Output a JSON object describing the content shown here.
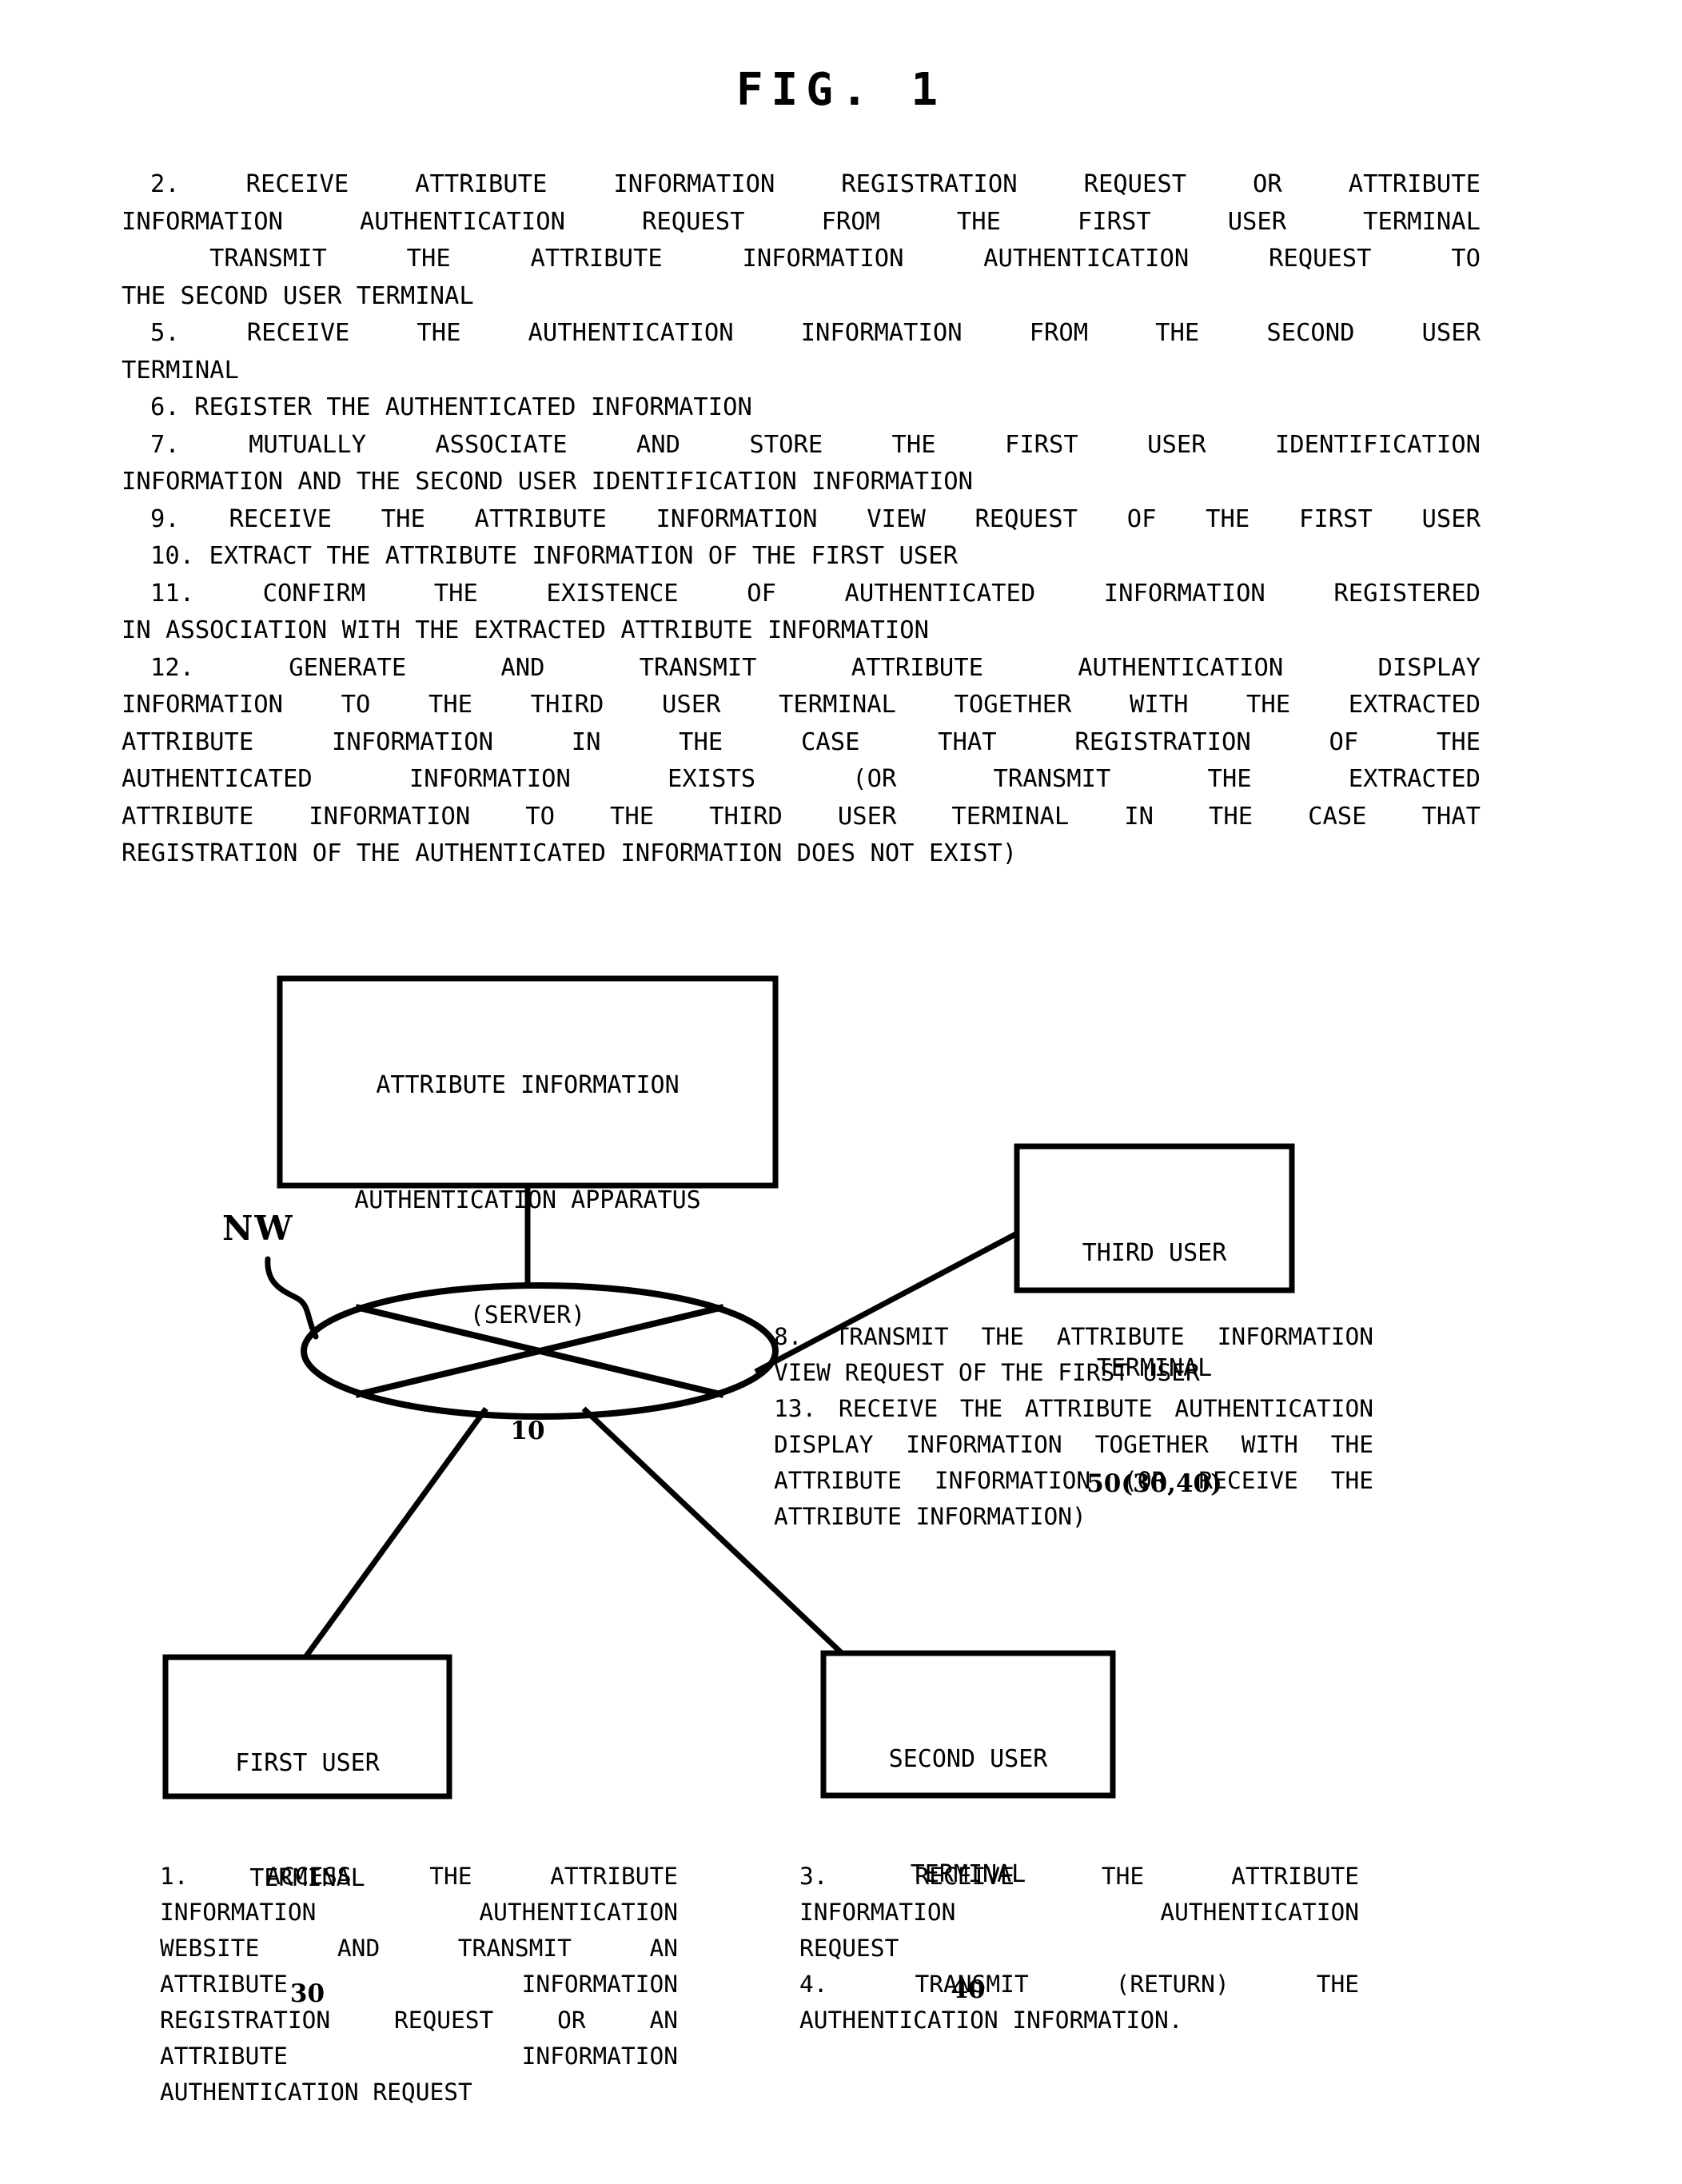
{
  "figure": {
    "title": "FIG. 1"
  },
  "top_steps": [
    {
      "text": "2. RECEIVE ATTRIBUTE INFORMATION REGISTRATION REQUEST OR ATTRIBUTE",
      "justify": true,
      "indent": 36
    },
    {
      "text": "INFORMATION AUTHENTICATION REQUEST FROM THE FIRST USER TERMINAL",
      "justify": true,
      "indent": 0
    },
    {
      "text": "TRANSMIT THE ATTRIBUTE INFORMATION AUTHENTICATION REQUEST TO",
      "justify": true,
      "indent": 110
    },
    {
      "text": "THE SECOND USER TERMINAL",
      "justify": false,
      "indent": 0
    },
    {
      "text": "5. RECEIVE THE AUTHENTICATION INFORMATION FROM THE SECOND USER",
      "justify": true,
      "indent": 36
    },
    {
      "text": "TERMINAL",
      "justify": false,
      "indent": 0
    },
    {
      "text": "6. REGISTER THE AUTHENTICATED INFORMATION",
      "justify": false,
      "indent": 36
    },
    {
      "text": "7. MUTUALLY ASSOCIATE AND STORE THE FIRST USER IDENTIFICATION",
      "justify": true,
      "indent": 36
    },
    {
      "text": "INFORMATION AND THE SECOND USER IDENTIFICATION INFORMATION",
      "justify": false,
      "indent": 0
    },
    {
      "text": "9. RECEIVE THE ATTRIBUTE INFORMATION VIEW REQUEST OF THE FIRST USER",
      "justify": true,
      "indent": 36
    },
    {
      "text": "10. EXTRACT THE ATTRIBUTE INFORMATION OF THE FIRST USER",
      "justify": false,
      "indent": 36
    },
    {
      "text": "11. CONFIRM THE EXISTENCE OF AUTHENTICATED INFORMATION REGISTERED",
      "justify": true,
      "indent": 36
    },
    {
      "text": "IN ASSOCIATION WITH THE EXTRACTED ATTRIBUTE INFORMATION",
      "justify": false,
      "indent": 0
    },
    {
      "text": "12. GENERATE AND TRANSMIT ATTRIBUTE AUTHENTICATION DISPLAY",
      "justify": true,
      "indent": 36
    },
    {
      "text": "INFORMATION TO THE THIRD USER TERMINAL TOGETHER WITH THE EXTRACTED",
      "justify": true,
      "indent": 0
    },
    {
      "text": "ATTRIBUTE INFORMATION IN THE CASE THAT REGISTRATION OF THE",
      "justify": true,
      "indent": 0
    },
    {
      "text": "AUTHENTICATED INFORMATION EXISTS (OR TRANSMIT THE EXTRACTED",
      "justify": true,
      "indent": 0
    },
    {
      "text": "ATTRIBUTE INFORMATION TO THE THIRD USER TERMINAL IN THE CASE THAT",
      "justify": true,
      "indent": 0
    },
    {
      "text": "REGISTRATION OF THE AUTHENTICATED INFORMATION DOES NOT EXIST)",
      "justify": false,
      "indent": 0
    }
  ],
  "diagram": {
    "server_box": {
      "line1": "ATTRIBUTE INFORMATION",
      "line2": "AUTHENTICATION APPARATUS",
      "line3": "(SERVER)",
      "ref": "10"
    },
    "network": {
      "label": "NW"
    },
    "third_user_box": {
      "line1": "THIRD USER",
      "line2": "TERMINAL",
      "ref": "50(30,40)"
    },
    "first_user_box": {
      "line1": "FIRST USER",
      "line2": "TERMINAL",
      "ref": "30"
    },
    "second_user_box": {
      "line1": "SECOND USER",
      "line2": "TERMINAL",
      "ref": "40"
    }
  },
  "side_steps": [
    {
      "text": "8. TRANSMIT THE ATTRIBUTE INFORMATION",
      "justify": true
    },
    {
      "text": "VIEW REQUEST OF THE FIRST USER",
      "justify": false
    },
    {
      "text": "13. RECEIVE THE ATTRIBUTE AUTHENTICATION",
      "justify": true
    },
    {
      "text": "DISPLAY INFORMATION TOGETHER WITH THE",
      "justify": true
    },
    {
      "text": "ATTRIBUTE INFORMATION (OR RECEIVE THE",
      "justify": true
    },
    {
      "text": "ATTRIBUTE INFORMATION)",
      "justify": false
    }
  ],
  "bottom_left_steps": [
    {
      "text": "1. ACCESS THE ATTRIBUTE",
      "justify": true
    },
    {
      "text": "INFORMATION AUTHENTICATION",
      "justify": true
    },
    {
      "text": "WEBSITE AND TRANSMIT AN",
      "justify": true
    },
    {
      "text": "ATTRIBUTE INFORMATION",
      "justify": true
    },
    {
      "text": "REGISTRATION REQUEST OR AN",
      "justify": true
    },
    {
      "text": "ATTRIBUTE INFORMATION",
      "justify": true
    },
    {
      "text": "AUTHENTICATION REQUEST",
      "justify": false
    }
  ],
  "bottom_right_steps": [
    {
      "text": "3. RECEIVE THE ATTRIBUTE",
      "justify": true
    },
    {
      "text": "INFORMATION AUTHENTICATION",
      "justify": true
    },
    {
      "text": "REQUEST",
      "justify": false
    },
    {
      "text": "4. TRANSMIT (RETURN) THE",
      "justify": true
    },
    {
      "text": "AUTHENTICATION INFORMATION.",
      "justify": false
    }
  ],
  "colors": {
    "ink": "#000000",
    "paper": "#ffffff"
  }
}
